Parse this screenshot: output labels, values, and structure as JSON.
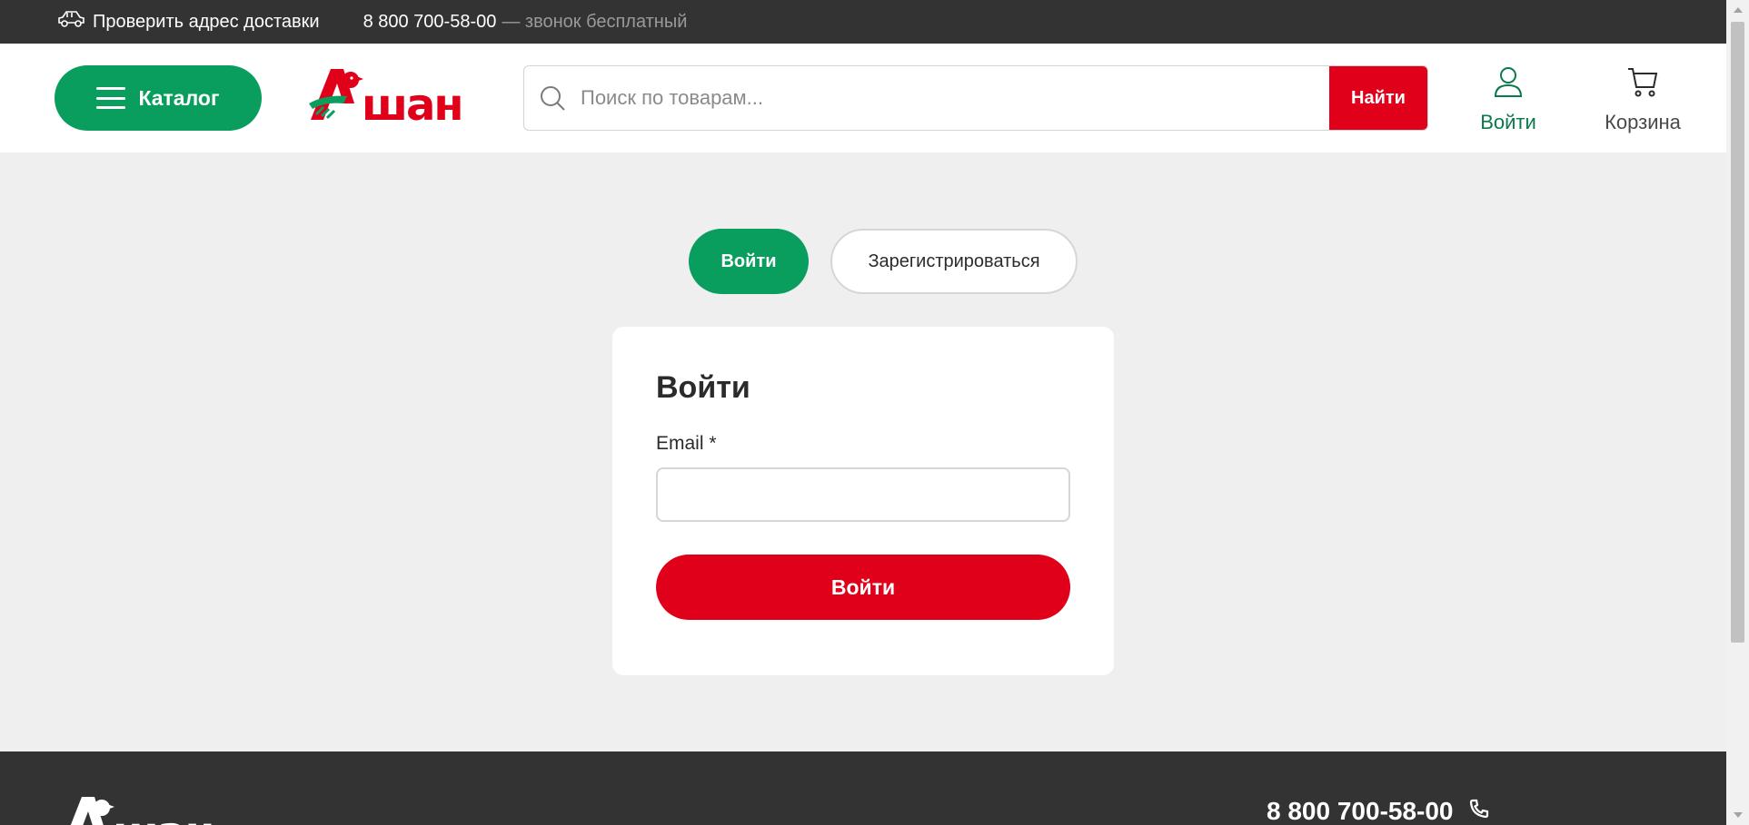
{
  "topbar": {
    "delivery_label": "Проверить адрес доставки",
    "phone": "8 800 700-58-00",
    "phone_note": "— звонок бесплатный"
  },
  "header": {
    "catalog_label": "Каталог",
    "logo_alt": "Ашан",
    "search": {
      "placeholder": "Поиск по товарам...",
      "button_label": "Найти"
    },
    "login_label": "Войти",
    "cart_label": "Корзина"
  },
  "auth_tabs": {
    "login_label": "Войти",
    "register_label": "Зарегистрироваться",
    "active": "login"
  },
  "login_form": {
    "title": "Войти",
    "email_label": "Email *",
    "email_value": "",
    "submit_label": "Войти"
  },
  "footer": {
    "phone": "8 800 700-58-00"
  },
  "colors": {
    "brand_green": "#0a9e5e",
    "brand_red": "#e0001a",
    "dark_bar": "#333333",
    "page_bg": "#efefef"
  },
  "icons": {
    "delivery": "car-icon",
    "menu": "hamburger-icon",
    "search": "search-icon",
    "user": "user-icon",
    "cart": "cart-icon",
    "phone": "phone-icon"
  }
}
